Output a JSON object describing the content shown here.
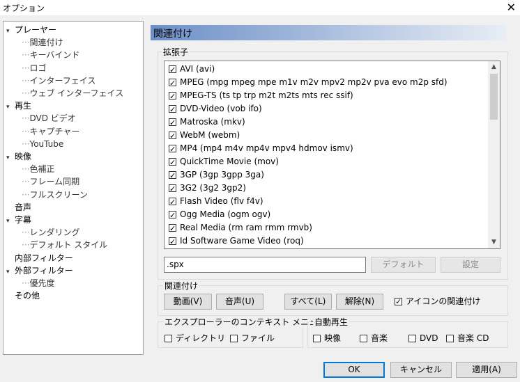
{
  "window": {
    "title": "オプション",
    "close_glyph": "✕"
  },
  "tree": [
    {
      "label": "プレーヤー",
      "level": 0,
      "toggle": "▾"
    },
    {
      "label": "関連付け",
      "level": 1
    },
    {
      "label": "キーバインド",
      "level": 1
    },
    {
      "label": "ロゴ",
      "level": 1
    },
    {
      "label": "インターフェイス",
      "level": 1
    },
    {
      "label": "ウェブ インターフェイス",
      "level": 1
    },
    {
      "label": "再生",
      "level": 0,
      "toggle": "▾"
    },
    {
      "label": "DVD ビデオ",
      "level": 1
    },
    {
      "label": "キャプチャー",
      "level": 1
    },
    {
      "label": "YouTube",
      "level": 1
    },
    {
      "label": "映像",
      "level": 0,
      "toggle": "▾"
    },
    {
      "label": "色補正",
      "level": 1
    },
    {
      "label": "フレーム同期",
      "level": 1
    },
    {
      "label": "フルスクリーン",
      "level": 1
    },
    {
      "label": "音声",
      "level": 0,
      "toggle": ""
    },
    {
      "label": "字幕",
      "level": 0,
      "toggle": "▾"
    },
    {
      "label": "レンダリング",
      "level": 1
    },
    {
      "label": "デフォルト スタイル",
      "level": 1
    },
    {
      "label": "内部フィルター",
      "level": 0,
      "toggle": ""
    },
    {
      "label": "外部フィルター",
      "level": 0,
      "toggle": "▾"
    },
    {
      "label": "優先度",
      "level": 1
    },
    {
      "label": "その他",
      "level": 0,
      "toggle": ""
    }
  ],
  "panel": {
    "title": "関連付け",
    "extensions_label": "拡張子",
    "extensions": [
      {
        "label": "AVI (avi)",
        "checked": true
      },
      {
        "label": "MPEG (mpg mpeg mpe m1v m2v mpv2 mp2v pva evo m2p sfd)",
        "checked": true
      },
      {
        "label": "MPEG-TS (ts tp trp m2t m2ts mts rec ssif)",
        "checked": true
      },
      {
        "label": "DVD-Video (vob ifo)",
        "checked": true
      },
      {
        "label": "Matroska (mkv)",
        "checked": true
      },
      {
        "label": "WebM (webm)",
        "checked": true
      },
      {
        "label": "MP4 (mp4 m4v mp4v mpv4 hdmov ismv)",
        "checked": true
      },
      {
        "label": "QuickTime Movie (mov)",
        "checked": true
      },
      {
        "label": "3GP (3gp 3gpp 3ga)",
        "checked": true
      },
      {
        "label": "3G2 (3g2 3gp2)",
        "checked": true
      },
      {
        "label": "Flash Video (flv f4v)",
        "checked": true
      },
      {
        "label": "Ogg Media (ogm ogv)",
        "checked": true
      },
      {
        "label": "Real Media (rm ram rmm rmvb)",
        "checked": true
      },
      {
        "label": "Id Software Game Video (roq)",
        "checked": true
      }
    ],
    "extension_value": ".spx",
    "default_button": "デフォルト",
    "settings_button": "設定",
    "association_label": "関連付け",
    "video_button": "動画(V)",
    "audio_button": "音声(U)",
    "all_button": "すべて(L)",
    "clear_button": "解除(N)",
    "icon_assoc_label": "アイコンの関連付け",
    "explorer_label": "エクスプローラーのコンテキスト メニュー",
    "directory_label": "ディレクトリ",
    "file_label": "ファイル",
    "autoplay_label": "自動再生",
    "autoplay_video": "映像",
    "autoplay_music": "音楽",
    "autoplay_dvd": "DVD",
    "autoplay_cd": "音楽 CD"
  },
  "footer": {
    "ok": "OK",
    "cancel": "キャンセル",
    "apply": "適用(A)"
  }
}
